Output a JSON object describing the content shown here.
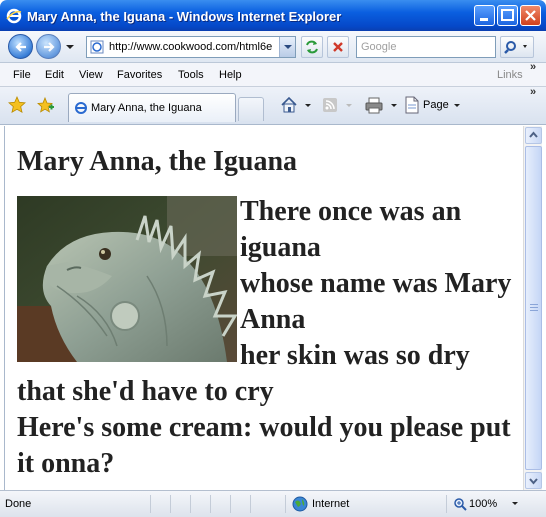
{
  "window": {
    "title": "Mary Anna, the Iguana - Windows Internet Explorer"
  },
  "address_bar": {
    "url": "http://www.cookwood.com/html6e",
    "search_placeholder": "Google"
  },
  "menu": {
    "items": [
      "File",
      "Edit",
      "View",
      "Favorites",
      "Tools",
      "Help"
    ],
    "links_label": "Links"
  },
  "tab": {
    "label": "Mary Anna, the Iguana"
  },
  "command_bar": {
    "page_label": "Page"
  },
  "page": {
    "heading": "Mary Anna, the Iguana",
    "poem_lines": [
      "There once was an iguana",
      "whose name was Mary Anna",
      "her skin was so dry",
      "that she'd have to cry",
      "Here's some cream: would you please put it onna?"
    ]
  },
  "status_bar": {
    "status": "Done",
    "zone": "Internet",
    "zoom": "100%"
  },
  "colors": {
    "titlebar": "#0a5fe0",
    "heading_text": "#222222"
  }
}
